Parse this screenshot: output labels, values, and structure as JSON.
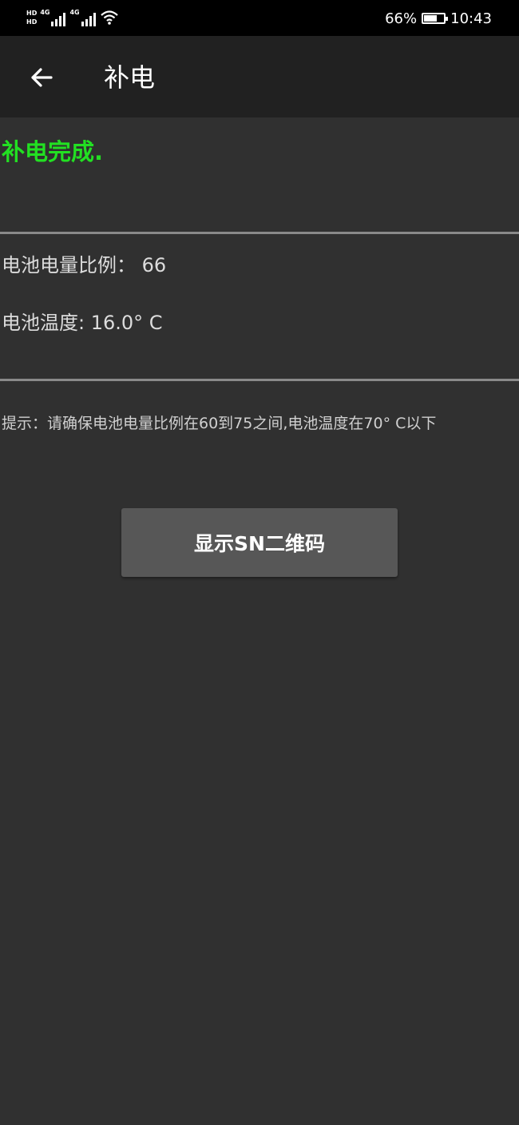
{
  "status_bar": {
    "hd_labels": [
      "HD",
      "HD"
    ],
    "sim1_label": "4G",
    "sim2_label": "4G",
    "battery_percent_text": "66%",
    "battery_level": 0.66,
    "time": "10:43",
    "icons": [
      "signal-icon",
      "wifi-icon",
      "battery-charging-icon"
    ]
  },
  "app_bar": {
    "back_icon": "arrow-left-icon",
    "title": "补电"
  },
  "main": {
    "status_message": "补电完成.",
    "status_color": "#22e022",
    "battery_ratio_text": "电池电量比例：  66",
    "battery_temperature_text": "电池温度: 16.0° C",
    "hint_text": "提示：请确保电池电量比例在60到75之间,电池温度在70° C以下",
    "show_sn_button_label": "显示SN二维码"
  },
  "colors": {
    "background": "#303030",
    "app_bar": "#212121",
    "button": "#575757"
  }
}
